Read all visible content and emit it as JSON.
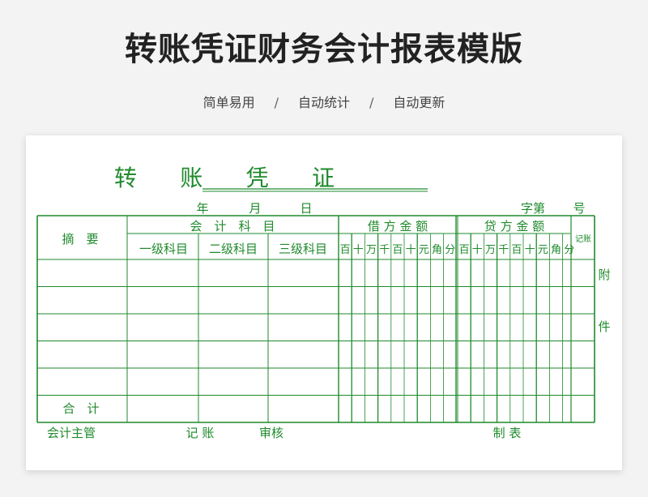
{
  "page": {
    "title": "转账凭证财务会计报表模版",
    "tags": [
      "简单易用",
      "自动统计",
      "自动更新"
    ],
    "separator": "/"
  },
  "voucher": {
    "title": "转　账　凭　证",
    "date": {
      "year": "年",
      "month": "月",
      "day": "日"
    },
    "number": {
      "zi": "字第",
      "hao": "号"
    },
    "headers": {
      "summary": "摘　要",
      "account": "会　计　科　目",
      "debit": "借 方 金 额",
      "credit": "贷 方 金 额",
      "level1": "一级科目",
      "level2": "二级科目",
      "level3": "三级科目",
      "posted": "记账"
    },
    "digit_units": [
      "百",
      "十",
      "万",
      "千",
      "百",
      "十",
      "元",
      "角",
      "分"
    ],
    "attachment": {
      "fu": "附",
      "jian": "件"
    },
    "total_label": "合　计",
    "footer": {
      "chief": "会计主管",
      "bookkeeper": "记 账",
      "reviewer": "审核",
      "maker": "制 表"
    },
    "line_color": "#1f8a2c",
    "body_rows": 5
  }
}
